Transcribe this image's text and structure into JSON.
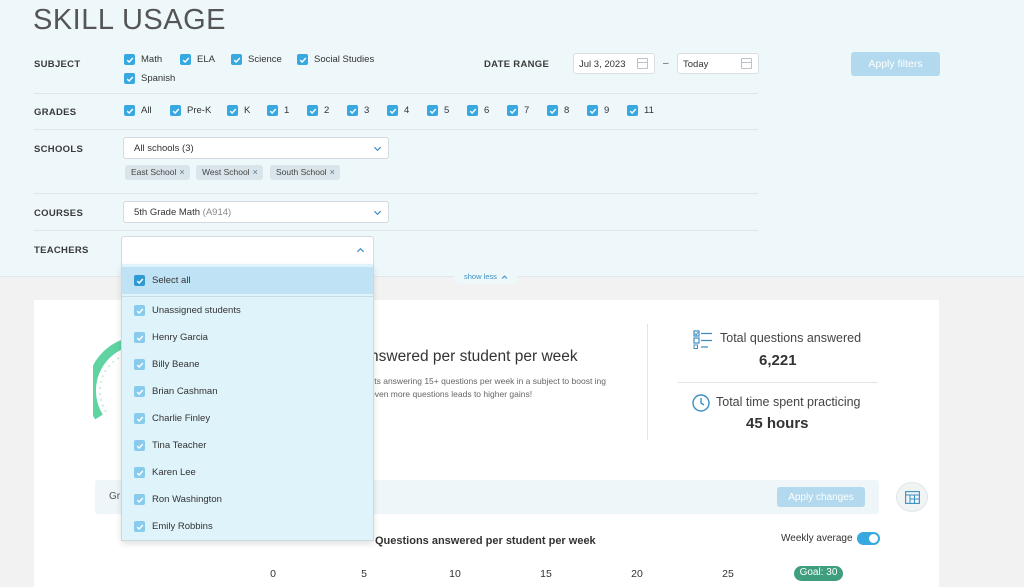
{
  "page": {
    "title": "SKILL USAGE"
  },
  "filters": {
    "subject": {
      "label": "SUBJECT",
      "options": [
        "Math",
        "ELA",
        "Science",
        "Social Studies",
        "Spanish"
      ]
    },
    "date_range": {
      "label": "DATE RANGE",
      "start": "Jul 3, 2023",
      "separator": "–",
      "end": "Today"
    },
    "apply_label": "Apply filters",
    "grades": {
      "label": "GRADES",
      "options": [
        "All",
        "Pre-K",
        "K",
        "1",
        "2",
        "3",
        "4",
        "5",
        "6",
        "7",
        "8",
        "9",
        "11"
      ]
    },
    "schools": {
      "label": "SCHOOLS",
      "selected": "All schools (3)",
      "chips": [
        "East School",
        "West School",
        "South School"
      ],
      "chip_remove": "×"
    },
    "courses": {
      "label": "COURSES",
      "selected": "5th Grade Math",
      "code": "(A914)"
    },
    "teachers": {
      "label": "TEACHERS",
      "options": [
        "Select all",
        "Unassigned students",
        "Henry Garcia",
        "Billy Beane",
        "Brian Cashman",
        "Charlie Finley",
        "Tina Teacher",
        "Karen Lee",
        "Ron Washington",
        "Emily Robbins"
      ]
    },
    "show_less": "show less"
  },
  "summary": {
    "headline": "nswered per student per week",
    "hint": "sts answering 15+ questions per week in a subject to boost ing even more questions leads to higher gains!",
    "total_questions_label": "Total questions answered",
    "total_questions_value": "6,221",
    "total_time_label": "Total time spent practicing",
    "total_time_value": "45 hours"
  },
  "group_bar": {
    "text": "Gr",
    "apply_label": "Apply changes"
  },
  "chart": {
    "title": "Questions answered per student per week",
    "toggle_label": "Weekly average",
    "ticks": [
      "0",
      "5",
      "10",
      "15",
      "20",
      "25"
    ],
    "goal_label": "Goal: 30"
  },
  "colors": {
    "accent": "#38a8e0",
    "filter_bg": "#eef8fb",
    "goal": "#3f9e7d",
    "gauge": "#5fd3a1"
  }
}
